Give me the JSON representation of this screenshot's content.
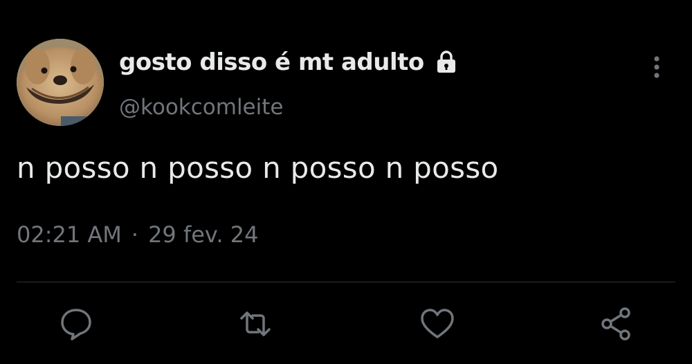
{
  "user": {
    "display_name": "gosto disso é mt adulto",
    "handle": "@kookcomleite",
    "avatar_icon": "dog-face-avatar",
    "verified_icon": "lock-icon"
  },
  "tweet": {
    "text": "n posso n posso n posso n posso",
    "time": "02:21 AM",
    "separator": "·",
    "date": "29 fev. 24"
  },
  "actions": [
    {
      "icon": "reply-icon"
    },
    {
      "icon": "retweet-icon"
    },
    {
      "icon": "like-icon"
    },
    {
      "icon": "share-icon"
    }
  ],
  "colors": {
    "background": "#000000",
    "primary_text": "#e7e9ea",
    "secondary_text": "#71767b",
    "divider": "#2f3336"
  }
}
